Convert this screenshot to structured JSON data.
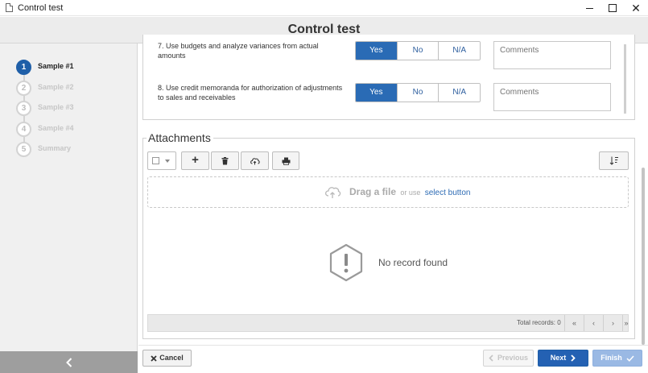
{
  "window": {
    "title": "Control test",
    "minimize": "",
    "maximize": "",
    "close": "✕"
  },
  "header": {
    "title": "Control test"
  },
  "steps": [
    {
      "number": "1",
      "label": "Sample #1",
      "active": true
    },
    {
      "number": "2",
      "label": "Sample #2",
      "active": false
    },
    {
      "number": "3",
      "label": "Sample #3",
      "active": false
    },
    {
      "number": "4",
      "label": "Sample #4",
      "active": false
    },
    {
      "number": "5",
      "label": "Summary",
      "active": false
    }
  ],
  "questions": [
    {
      "text": "7. Use budgets and analyze variances from actual amounts",
      "options": [
        "Yes",
        "No",
        "N/A"
      ],
      "selected": "Yes",
      "comment_placeholder": "Comments"
    },
    {
      "text": "8. Use credit memoranda for authorization of adjustments to sales and receivables",
      "options": [
        "Yes",
        "No",
        "N/A"
      ],
      "selected": "Yes",
      "comment_placeholder": "Comments"
    }
  ],
  "attachments": {
    "title": "Attachments",
    "toolbar": {
      "add": "+"
    },
    "dropzone": {
      "main": "Drag a file",
      "or": "or use",
      "link": "select button"
    },
    "empty": "No record found",
    "pager": {
      "total": "Total records: 0",
      "first": "«",
      "prev": "‹",
      "next": "›",
      "last": "»"
    }
  },
  "footer": {
    "cancel": "Cancel",
    "previous": "Previous",
    "next": "Next",
    "finish": "Finish"
  },
  "colors": {
    "accent": "#2461b3",
    "selected_segment": "#2a6bb5",
    "finish_disabled": "#9ab9e4"
  }
}
